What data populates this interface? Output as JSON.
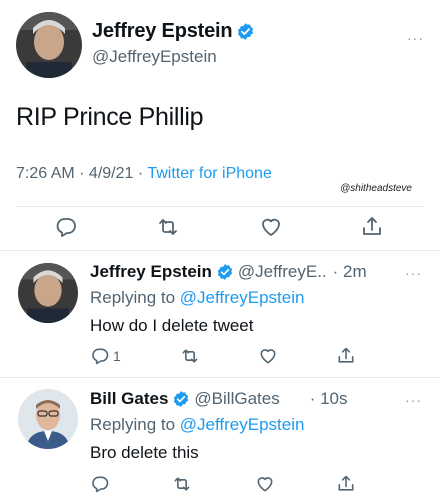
{
  "main_tweet": {
    "name": "Jeffrey Epstein",
    "handle": "@JeffreyEpstein",
    "text": "RIP Prince Phillip",
    "time": "7:26 AM · 4/9/21 · ",
    "source": "Twitter for iPhone",
    "watermark": "@shitheadsteve",
    "more": "···"
  },
  "replies": [
    {
      "name": "Jeffrey Epstein",
      "handle": "@JeffreyE..",
      "time": "· 2m",
      "replying_prefix": "Replying to ",
      "replying_to": "@JeffreyEpstein",
      "text": "How do I delete tweet",
      "reply_count": "1",
      "more": "···"
    },
    {
      "name": "Bill Gates",
      "handle": "@BillGates",
      "time": "· 10s",
      "replying_prefix": "Replying to ",
      "replying_to": "@JeffreyEpstein",
      "text": "Bro delete this",
      "reply_count": "",
      "more": "···"
    }
  ],
  "colors": {
    "accent": "#1d9bf0",
    "muted": "#536471",
    "divider": "#e6ecf0"
  },
  "icons": [
    "verified-badge-icon",
    "reply-icon",
    "retweet-icon",
    "like-icon",
    "share-icon",
    "more-icon"
  ]
}
